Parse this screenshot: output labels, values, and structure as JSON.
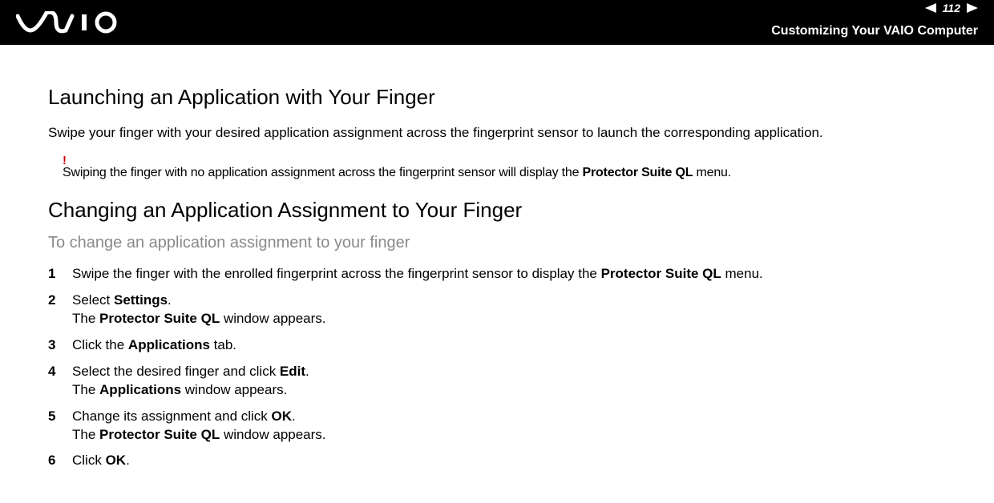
{
  "header": {
    "page_number": "112",
    "title": "Customizing Your VAIO Computer"
  },
  "section1": {
    "heading": "Launching an Application with Your Finger",
    "paragraph": "Swipe your finger with your desired application assignment across the fingerprint sensor to launch the corresponding application.",
    "note_mark": "!",
    "note_pre": "Swiping the finger with no application assignment across the fingerprint sensor will display the ",
    "note_bold": "Protector Suite QL",
    "note_post": " menu."
  },
  "section2": {
    "heading": "Changing an Application Assignment to Your Finger",
    "subheading": "To change an application assignment to your finger",
    "steps": {
      "s1": {
        "num": "1",
        "t1": "Swipe the finger with the enrolled fingerprint across the fingerprint sensor to display the ",
        "b1": "Protector Suite QL",
        "t2": " menu."
      },
      "s2": {
        "num": "2",
        "t1": "Select ",
        "b1": "Settings",
        "t2": ".",
        "line2_t1": "The ",
        "line2_b1": "Protector Suite QL",
        "line2_t2": " window appears."
      },
      "s3": {
        "num": "3",
        "t1": "Click the ",
        "b1": "Applications",
        "t2": " tab."
      },
      "s4": {
        "num": "4",
        "t1": "Select the desired finger and click ",
        "b1": "Edit",
        "t2": ".",
        "line2_t1": "The ",
        "line2_b1": "Applications",
        "line2_t2": " window appears."
      },
      "s5": {
        "num": "5",
        "t1": "Change its assignment and click ",
        "b1": "OK",
        "t2": ".",
        "line2_t1": "The ",
        "line2_b1": "Protector Suite QL",
        "line2_t2": " window appears."
      },
      "s6": {
        "num": "6",
        "t1": "Click ",
        "b1": "OK",
        "t2": "."
      }
    }
  }
}
